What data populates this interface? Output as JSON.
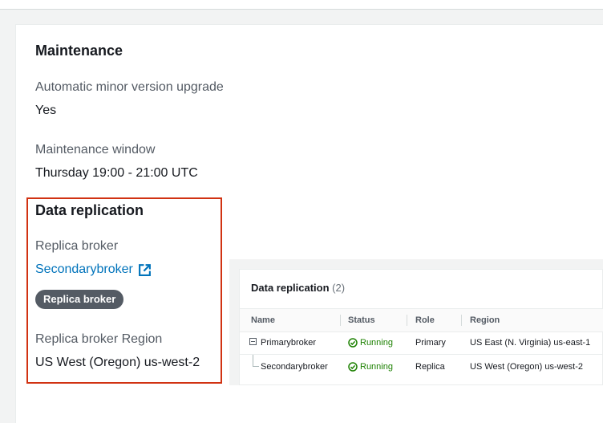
{
  "maintenance": {
    "title": "Maintenance",
    "auto_upgrade_label": "Automatic minor version upgrade",
    "auto_upgrade_value": "Yes",
    "window_label": "Maintenance window",
    "window_value": "Thursday 19:00 - 21:00 UTC"
  },
  "data_replication": {
    "title": "Data replication",
    "replica_broker_label": "Replica broker",
    "replica_broker_link": "Secondarybroker",
    "replica_badge": "Replica broker",
    "replica_region_label": "Replica broker Region",
    "replica_region_value": "US West (Oregon) us-west-2"
  },
  "panel": {
    "title": "Data replication",
    "count": "(2)",
    "columns": [
      "Name",
      "Status",
      "Role",
      "Region"
    ],
    "rows": [
      {
        "name": "Primarybroker",
        "status": "Running",
        "role": "Primary",
        "region": "US East (N. Virginia) us-east-1"
      },
      {
        "name": "Secondarybroker",
        "status": "Running",
        "role": "Replica",
        "region": "US West (Oregon) us-west-2"
      }
    ]
  },
  "colors": {
    "link": "#0073bb",
    "running": "#1d8102",
    "highlight": "#d13212",
    "badge": "#545b64"
  },
  "icons": [
    "external-link-icon",
    "status-success-icon",
    "tree-collapse-icon"
  ]
}
